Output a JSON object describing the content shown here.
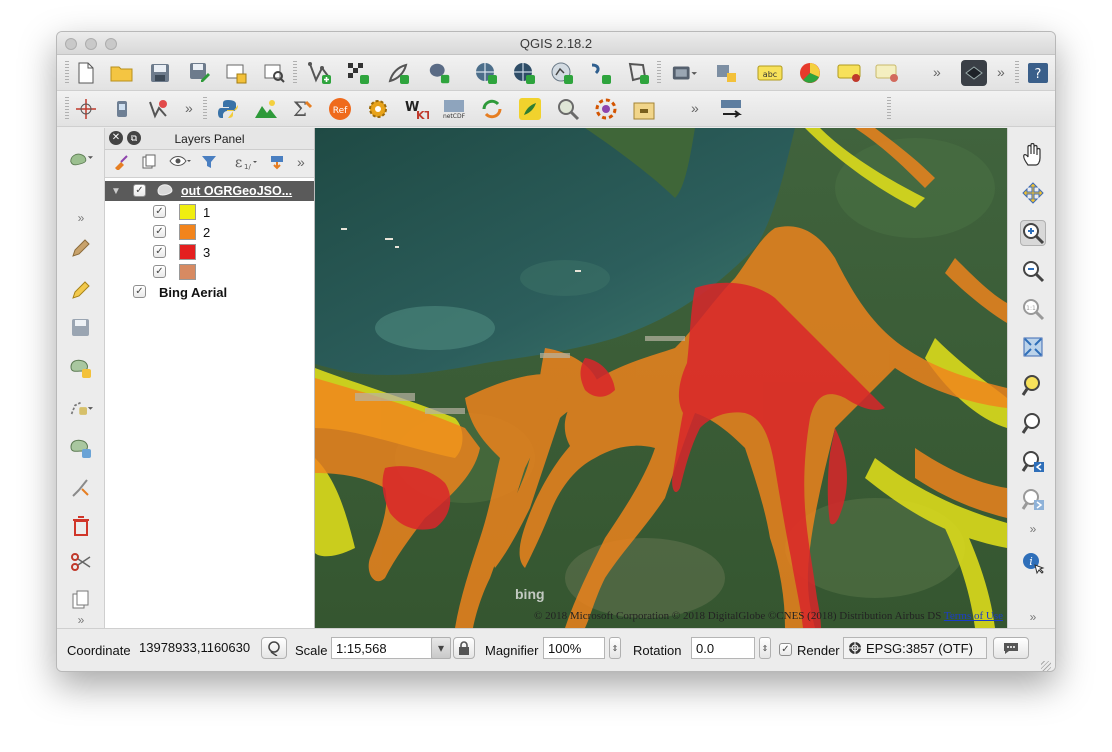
{
  "window": {
    "title": "QGIS 2.18.2"
  },
  "layers_panel": {
    "title": "Layers Panel",
    "layers": [
      {
        "name": "out OGRGeoJSO...",
        "checked": true,
        "classes": [
          {
            "label": "1",
            "color": "#f0ee10"
          },
          {
            "label": "2",
            "color": "#f2841c"
          },
          {
            "label": "3",
            "color": "#e41f1f"
          },
          {
            "label": "",
            "color": "#d78a62"
          }
        ]
      },
      {
        "name": "Bing Aerial",
        "checked": true
      }
    ]
  },
  "map": {
    "bing_logo": "bing",
    "attribution": "© 2018 Microsoft Corporation © 2018 DigitalGlobe ©CNES (2018) Distribution Airbus DS",
    "terms_link": "Terms of Use"
  },
  "statusbar": {
    "coordinate_label": "Coordinate",
    "coordinate_value": "13978933,1160630",
    "scale_label": "Scale",
    "scale_value": "1:15,568",
    "magnifier_label": "Magnifier",
    "magnifier_value": "100%",
    "rotation_label": "Rotation",
    "rotation_value": "0.0",
    "render_label": "Render",
    "render_checked": true,
    "crs_label": "EPSG:3857 (OTF)"
  },
  "toolbar_icons": {
    "row1": [
      "new-project-icon",
      "open-project-icon",
      "save-project-icon",
      "save-as-icon",
      "new-print-composer-icon",
      "composer-manager-icon",
      "add-vector-layer-icon",
      "add-raster-layer-icon",
      "add-spatialite-icon",
      "add-postgis-icon",
      "add-wms-icon",
      "add-wcs-icon",
      "add-wfs-icon",
      "add-delimited-text-icon",
      "new-shapefile-icon",
      "add-virtual-layer-icon",
      "new-geopackage-icon",
      "label-abc-icon",
      "diagram-icon",
      "label-pin-icon",
      "label-move-icon",
      "dark-layer-icon",
      "help-icon"
    ],
    "row2": [
      "georeferencer-icon",
      "gps-icon",
      "geometry-checker-icon",
      "python-icon",
      "raster-terrain-icon",
      "field-calculator-icon",
      "ref-icon",
      "plugins-icon",
      "wkt-icon",
      "netcdf-icon",
      "sync-icon",
      "grass-icon",
      "identify-zoom-icon",
      "scan-icon",
      "db-manager-icon",
      "geojson-export-icon"
    ]
  }
}
